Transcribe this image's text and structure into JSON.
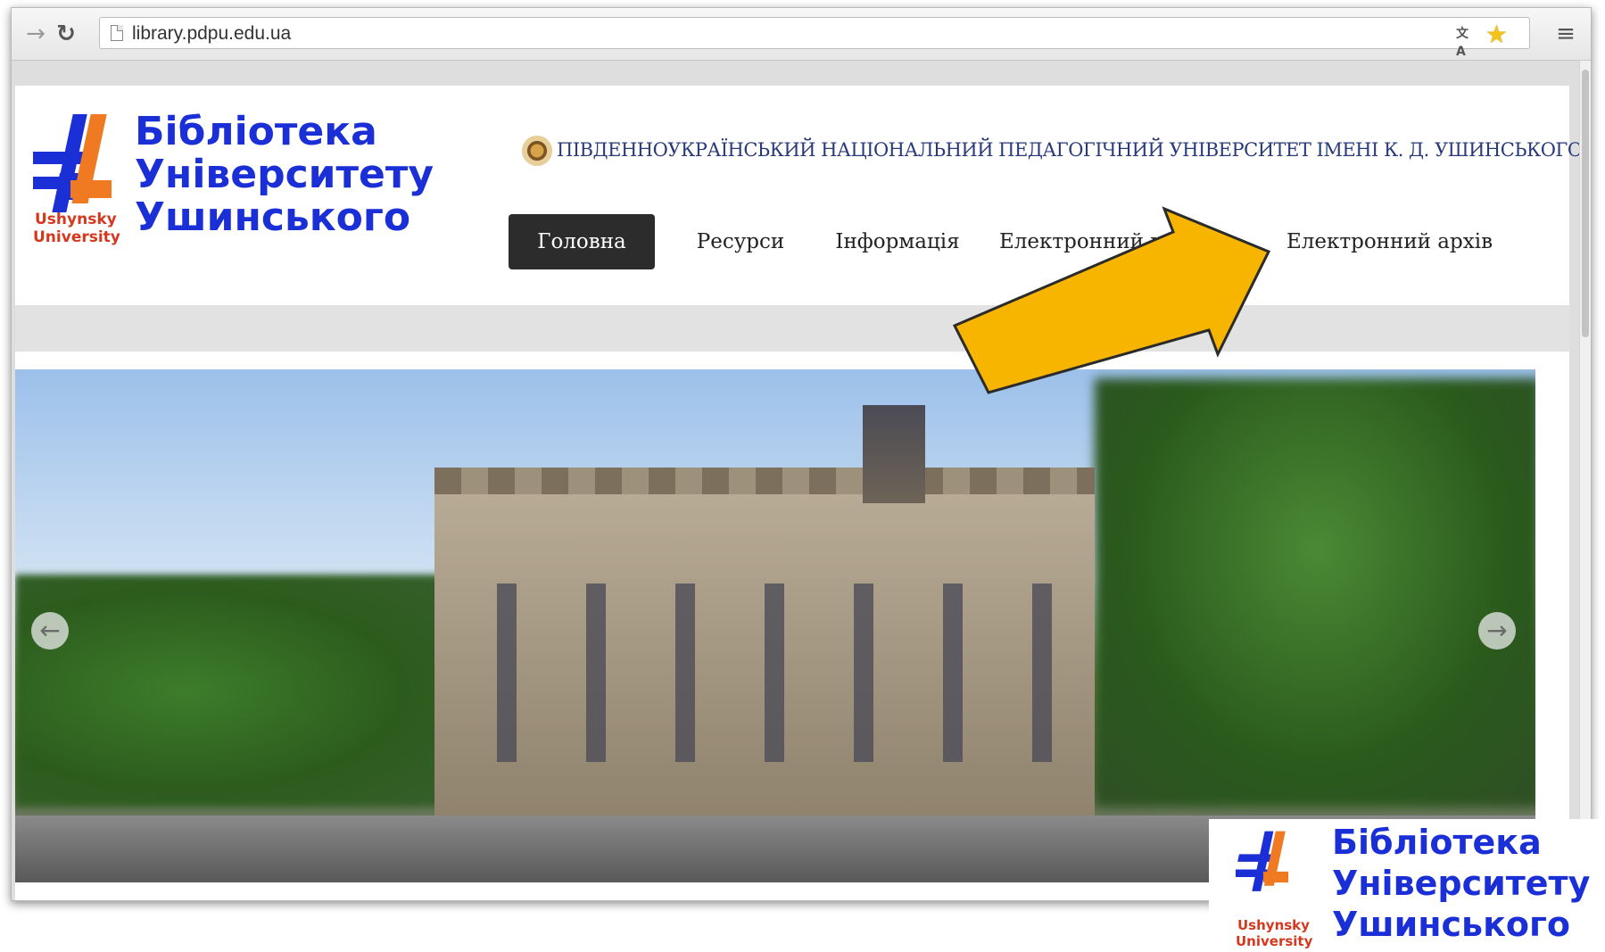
{
  "browser": {
    "url": "library.pdpu.edu.ua"
  },
  "logo": {
    "line1": "Бібліотека",
    "line2": "Університету",
    "line3": "Ушинського",
    "sub1": "Ushynsky",
    "sub2": "University"
  },
  "header": {
    "university_title": "ПІВДЕННОУКРАЇНСЬКИЙ НАЦІОНАЛЬНИЙ ПЕДАГОГІЧНИЙ УНІВЕРСИТЕТ ІМЕНІ К. Д. УШИНСЬКОГО"
  },
  "menu": {
    "items": [
      {
        "label": "Головна",
        "active": true
      },
      {
        "label": "Ресурси",
        "active": false
      },
      {
        "label": "Інформація",
        "active": false
      },
      {
        "label": "Електронний ката",
        "active": false
      },
      {
        "label": "Електронний архів",
        "active": false
      }
    ]
  },
  "colors": {
    "logo_blue": "#1b2fd6",
    "logo_orange": "#ef7a22",
    "logo_red": "#d4381e",
    "menu_active_bg": "#2c2c2c",
    "callout_arrow": "#f7b500"
  },
  "icons": {
    "back": "arrow-right-icon",
    "reload": "reload-icon",
    "slider_prev": "arrow-left-circle-icon",
    "slider_next": "arrow-right-circle-icon"
  }
}
